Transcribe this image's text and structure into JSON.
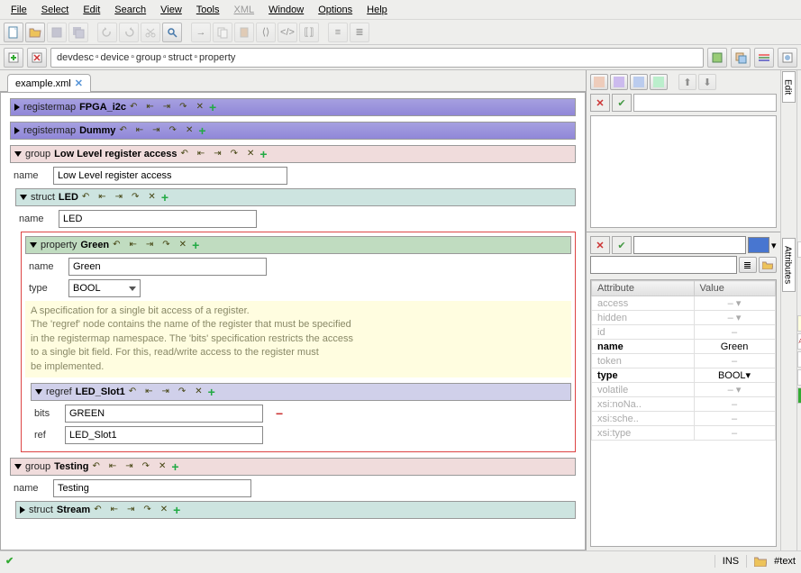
{
  "menu": {
    "file": "File",
    "select": "Select",
    "edit": "Edit",
    "search": "Search",
    "view": "View",
    "tools": "Tools",
    "xml": "XML",
    "window": "Window",
    "options": "Options",
    "help": "Help"
  },
  "breadcrumb": [
    "devdesc",
    "device",
    "group",
    "struct",
    "property"
  ],
  "tab": {
    "label": "example.xml"
  },
  "nodes": {
    "reg1": {
      "type": "registermap",
      "name": "FPGA_i2c"
    },
    "reg2": {
      "type": "registermap",
      "name": "Dummy"
    },
    "group1": {
      "type": "group",
      "name": "Low Level register access",
      "name_label": "name",
      "name_value": "Low Level register access"
    },
    "struct1": {
      "type": "struct",
      "name": "LED",
      "name_label": "name",
      "name_value": "LED"
    },
    "prop1": {
      "type": "property",
      "name": "Green",
      "name_label": "name",
      "name_value": "Green",
      "type_label": "type",
      "type_value": "BOOL"
    },
    "regref1": {
      "type": "regref",
      "name": "LED_Slot1",
      "bits_label": "bits",
      "bits_value": "GREEN",
      "ref_label": "ref",
      "ref_value": "LED_Slot1"
    },
    "group2": {
      "type": "group",
      "name": "Testing",
      "name_label": "name",
      "name_value": "Testing"
    },
    "struct2": {
      "type": "struct",
      "name": "Stream"
    }
  },
  "hint": {
    "l1": "A specification for a single bit access of a register.",
    "l2": "The 'regref' node contains the name of the register that must be specified",
    "l3": "in the registermap namespace. The 'bits' specification restricts the access",
    "l4": "to a single bit field. For this, read/write access to the register must",
    "l5": "be implemented."
  },
  "sidetabs": {
    "edit": "Edit",
    "attrs": "Attributes"
  },
  "attr_header": {
    "attribute": "Attribute",
    "value": "Value"
  },
  "attrs": [
    {
      "name": "access",
      "value": "– ▾",
      "faded": true
    },
    {
      "name": "hidden",
      "value": "– ▾",
      "faded": true
    },
    {
      "name": "id",
      "value": "–",
      "faded": true
    },
    {
      "name": "name",
      "value": "Green",
      "strong": true
    },
    {
      "name": "token",
      "value": "–",
      "faded": true
    },
    {
      "name": "type",
      "value": "BOOL▾",
      "strong": true
    },
    {
      "name": "volatile",
      "value": "– ▾",
      "faded": true
    },
    {
      "name": "xsi:noNa..",
      "value": "–",
      "faded": true
    },
    {
      "name": "xsi:sche..",
      "value": "–",
      "faded": true
    },
    {
      "name": "xsi:type",
      "value": "–",
      "faded": true
    }
  ],
  "status": {
    "ins": "INS",
    "text": "#text"
  }
}
